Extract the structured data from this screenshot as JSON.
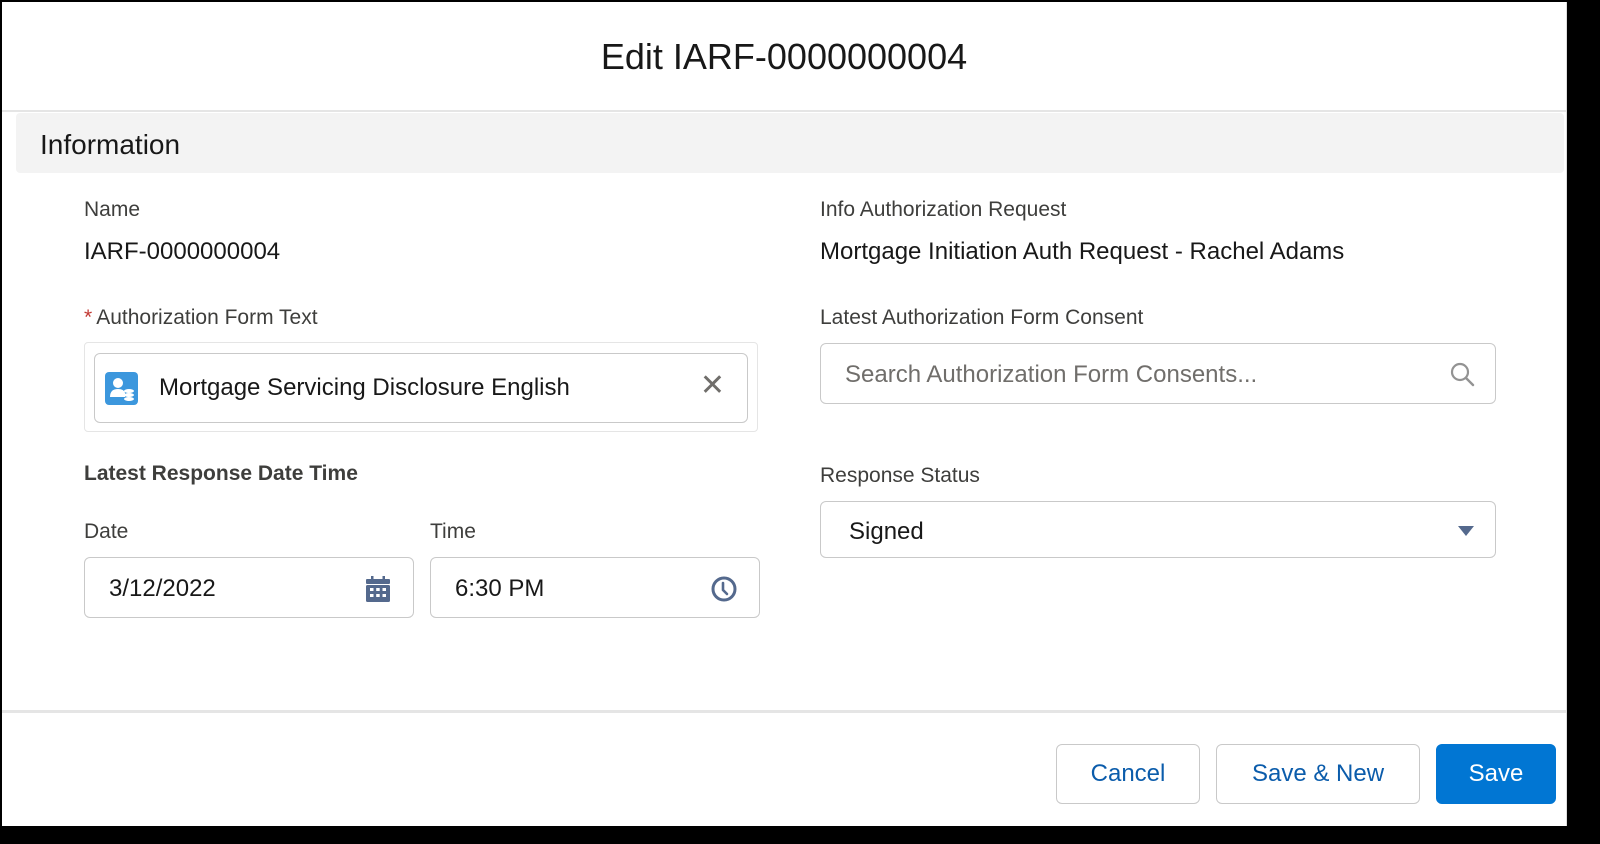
{
  "modal": {
    "title": "Edit IARF-0000000004",
    "section_title": "Information"
  },
  "fields": {
    "name": {
      "label": "Name",
      "value": "IARF-0000000004"
    },
    "info_auth_request": {
      "label": "Info Authorization Request",
      "value": "Mortgage Initiation Auth Request - Rachel Adams"
    },
    "auth_form_text": {
      "label": "Authorization Form Text",
      "required_marker": "*",
      "value": "Mortgage Servicing Disclosure English",
      "icon": "authorization-form-text-icon",
      "clear_icon": "close-icon"
    },
    "latest_consent": {
      "label": "Latest Authorization Form Consent",
      "placeholder": "Search Authorization Form Consents...",
      "icon": "search-icon"
    },
    "latest_response_datetime": {
      "label": "Latest Response Date Time",
      "date": {
        "label": "Date",
        "value": "3/12/2022",
        "icon": "calendar-icon"
      },
      "time": {
        "label": "Time",
        "value": "6:30 PM",
        "icon": "clock-icon"
      }
    },
    "response_status": {
      "label": "Response Status",
      "value": "Signed",
      "icon": "chevron-down-icon"
    }
  },
  "footer": {
    "cancel_label": "Cancel",
    "save_new_label": "Save & New",
    "save_label": "Save"
  },
  "colors": {
    "brand_blue": "#0176d3",
    "link_blue": "#0b5cab",
    "required_red": "#c23934",
    "icon_blue": "#3c97dd",
    "icon_slate": "#54698d"
  }
}
